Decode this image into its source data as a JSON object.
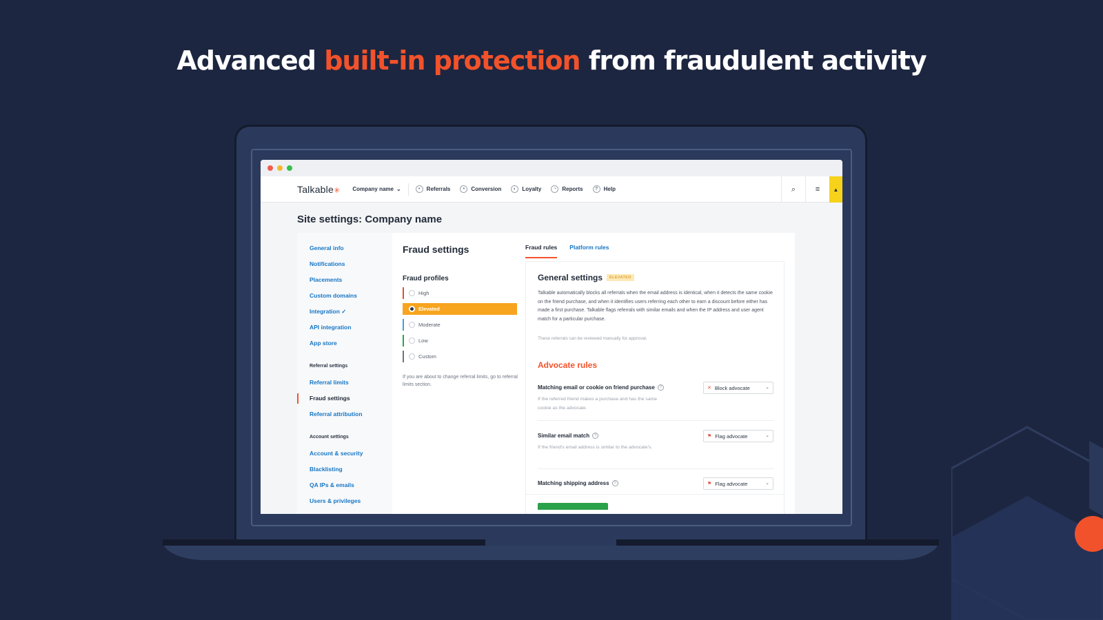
{
  "headline": {
    "part1": "Advanced ",
    "accent": "built-in protection",
    "part2": " from fraudulent activity",
    "accent_color": "#f2522b"
  },
  "appbar": {
    "logo": "Talkable",
    "company_dropdown": "Company name",
    "nav": [
      {
        "label": "Referrals",
        "icon": "referrals-icon"
      },
      {
        "label": "Conversion",
        "icon": "conversion-icon"
      },
      {
        "label": "Loyalty",
        "icon": "loyalty-icon"
      },
      {
        "label": "Reports",
        "icon": "reports-icon"
      },
      {
        "label": "Help",
        "icon": "help-icon"
      }
    ],
    "right_icons": [
      "search-icon",
      "menu-icon",
      "lock-icon"
    ]
  },
  "page_title": "Site settings: Company name",
  "sidebar": {
    "items": [
      {
        "label": "General info"
      },
      {
        "label": "Notifications"
      },
      {
        "label": "Placements"
      },
      {
        "label": "Custom domains"
      },
      {
        "label": "Integration ✓"
      },
      {
        "label": "API integration"
      },
      {
        "label": "App store"
      }
    ],
    "referral_heading": "Referral settings",
    "referral_items": [
      {
        "label": "Referral limits"
      },
      {
        "label": "Fraud settings"
      },
      {
        "label": "Referral attribution"
      }
    ],
    "account_heading": "Account settings",
    "account_items": [
      {
        "label": "Account & security"
      },
      {
        "label": "Blacklisting"
      },
      {
        "label": "QA IPs & emails"
      },
      {
        "label": "Users & privileges"
      }
    ]
  },
  "fraud": {
    "title": "Fraud settings",
    "profiles_title": "Fraud profiles",
    "profiles": [
      {
        "label": "High",
        "color": "#e14b3b"
      },
      {
        "label": "Elevated",
        "color": "#f7a51e"
      },
      {
        "label": "Moderate",
        "color": "#3aa0e0"
      },
      {
        "label": "Low",
        "color": "#2aa14b"
      },
      {
        "label": "Custom",
        "color": "#6b7380"
      }
    ],
    "selected_profile": "Elevated",
    "note": "If you are about to change referral limits, go to referral limits section."
  },
  "tabs": [
    {
      "label": "Fraud rules",
      "active": true
    },
    {
      "label": "Platform rules",
      "active": false
    }
  ],
  "general_settings": {
    "title": "General settings",
    "badge": "ELEVATED",
    "description": "Talkable automatically blocks all referrals when the email address is identical, when it detects the same cookie on the friend purchase, and when it identifies users referring each other to earn a discount before either has made a first purchase. Talkable flags referrals with similar emails and when the IP address and user agent match for a particular purchase.",
    "note": "These referrals can be reviewed manually for approval."
  },
  "advocate_rules": {
    "title": "Advocate rules",
    "rules": [
      {
        "label": "Matching email or cookie on friend purchase",
        "description": "If the referred friend makes a purchase and has the same cookie as the advocate.",
        "action": "Block advocate"
      },
      {
        "label": "Similar email match",
        "description": "If the friend's email address is similar to the advocate's.",
        "action": "Flag advocate"
      },
      {
        "label": "Matching shipping address",
        "description": "",
        "action": "Flag advocate"
      }
    ]
  }
}
